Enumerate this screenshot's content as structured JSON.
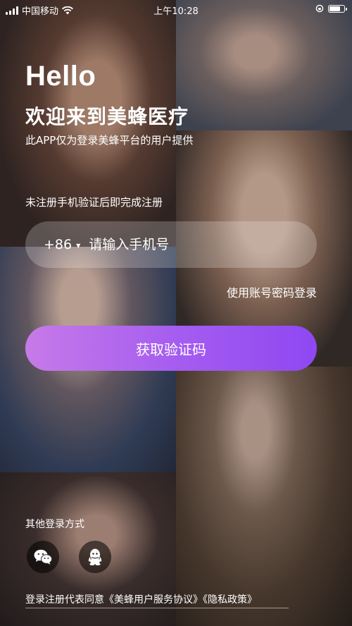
{
  "status_bar": {
    "carrier": "中国移动",
    "time": "上午10:28"
  },
  "header": {
    "greeting": "Hello",
    "welcome": "欢迎来到美蜂医疗",
    "notice": "此APP仅为登录美蜂平台的用户提供"
  },
  "form": {
    "register_tip": "未注册手机验证后即完成注册",
    "country_code": "+86",
    "phone_placeholder": "请输入手机号",
    "phone_value": "",
    "password_login_label": "使用账号密码登录",
    "get_code_label": "获取验证码"
  },
  "other_login": {
    "title": "其他登录方式",
    "options": [
      {
        "icon": "wechat-icon"
      },
      {
        "icon": "qq-icon"
      }
    ]
  },
  "agreement": {
    "text": "登录注册代表同意《美蜂用户服务协议》《隐私政策》"
  },
  "colors": {
    "button_gradient_start": "#c77ae8",
    "button_gradient_end": "#8f47f2"
  }
}
